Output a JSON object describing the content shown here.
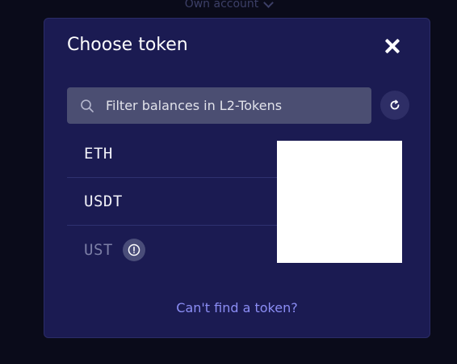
{
  "background": {
    "account_label": "Own account"
  },
  "modal": {
    "title": "Choose token",
    "close_icon": "close-icon",
    "search": {
      "placeholder": "Filter balances in L2-Tokens",
      "value": "",
      "icon": "search-icon"
    },
    "refresh_icon": "refresh-icon",
    "tokens": [
      {
        "symbol": "ETH",
        "disabled": false
      },
      {
        "symbol": "USDT",
        "disabled": false
      },
      {
        "symbol": "UST",
        "disabled": true,
        "warning_icon": "warning-icon"
      }
    ],
    "cant_find_label": "Can't find a token?"
  },
  "colors": {
    "modal_bg": "#1b1b52",
    "page_bg": "#0a0b1a",
    "accent_link": "#8b8df4",
    "search_bg": "#4b4e72"
  }
}
